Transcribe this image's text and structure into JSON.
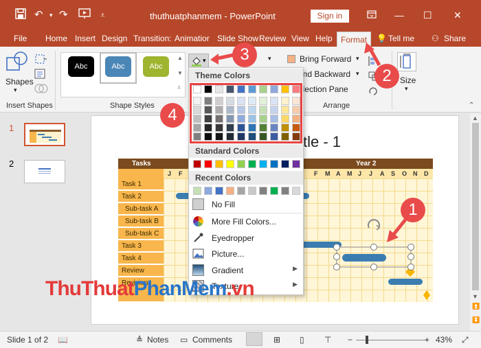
{
  "titlebar": {
    "doc_title": "thuthuatphanmem  -  PowerPoint",
    "sign_in": "Sign in"
  },
  "tabs": [
    "File",
    "Home",
    "Insert",
    "Design",
    "Transition:",
    "Animatior",
    "Slide Show",
    "Review",
    "View",
    "Help",
    "Format"
  ],
  "tell_me": "Tell me",
  "share": "Share",
  "ribbon": {
    "shapes_label": "Shapes",
    "insert_shapes": "Insert Shapes",
    "shape_styles": "Shape Styles",
    "style_boxes": [
      "Abc",
      "Abc",
      "Abc"
    ],
    "bring_forward": "Bring Forward",
    "send_backward": "Send Backward",
    "selection_pane": "Selection Pane",
    "arrange": "Arrange",
    "size": "Size"
  },
  "dropdown": {
    "theme_colors": "Theme Colors",
    "standard_colors": "Standard Colors",
    "recent_colors": "Recent Colors",
    "no_fill": "No Fill",
    "more_fill_colors": "More Fill Colors...",
    "eyedropper": "Eyedropper",
    "picture": "Picture...",
    "gradient": "Gradient",
    "texture": "Texture",
    "theme_top": [
      "#ffffff",
      "#000000",
      "#e7e6e6",
      "#44546a",
      "#4472c4",
      "#5b9bd5",
      "#a9d18e",
      "#8ea9db",
      "#ffc000",
      "#ff7c80"
    ],
    "theme_cols": [
      [
        "#f2f2f2",
        "#d9d9d9",
        "#bfbfbf",
        "#a6a6a6",
        "#808080"
      ],
      [
        "#7f7f7f",
        "#595959",
        "#404040",
        "#262626",
        "#0d0d0d"
      ],
      [
        "#d0cece",
        "#aeabab",
        "#757171",
        "#3a3838",
        "#171616"
      ],
      [
        "#d6dce4",
        "#adb9ca",
        "#8497b0",
        "#333f4f",
        "#222a35"
      ],
      [
        "#dae3f3",
        "#b4c7e7",
        "#8faadc",
        "#2f5597",
        "#203864"
      ],
      [
        "#deebf7",
        "#bdd7ee",
        "#9dc3e6",
        "#2e75b6",
        "#1f4e79"
      ],
      [
        "#e2f0d9",
        "#c5e0b4",
        "#a9d18e",
        "#548235",
        "#385723"
      ],
      [
        "#dae3f3",
        "#c5d2ee",
        "#a8bde6",
        "#6a85c2",
        "#3e5ca0"
      ],
      [
        "#fff2cc",
        "#ffe699",
        "#ffd966",
        "#bf9000",
        "#7f6000"
      ],
      [
        "#fbe5d6",
        "#f8cbad",
        "#f4b183",
        "#c55a11",
        "#843c0c"
      ]
    ],
    "standard": [
      "#c00000",
      "#ff0000",
      "#ffc000",
      "#ffff00",
      "#92d050",
      "#00b050",
      "#00b0f0",
      "#0070c0",
      "#002060",
      "#7030a0"
    ],
    "recent": [
      "#c6e0b4",
      "#8ea9db",
      "#4472c4",
      "#f4b183",
      "#a6a6a6",
      "#c9c9c9",
      "#808080",
      "#00b050",
      "#808080",
      "#d9d9d9"
    ]
  },
  "slide_panel": {
    "numbers": [
      "1",
      "2"
    ]
  },
  "slide": {
    "title_partial": "tle - 1",
    "year2": "Year 2",
    "months_y2": [
      "F",
      "M",
      "A",
      "M",
      "J",
      "J",
      "A",
      "S",
      "O",
      "N",
      "D"
    ],
    "months_y1_partial": [
      "J",
      "F"
    ],
    "tasks_header": "Tasks",
    "tasks": [
      "Task 1",
      "Task 2",
      "Sub-task A",
      "Sub-task B",
      "Sub-task C",
      "Task 3",
      "Task 4",
      "Review",
      "Revisions"
    ]
  },
  "callouts": [
    "1",
    "2",
    "3",
    "4"
  ],
  "watermark": {
    "part1": "ThuThuat",
    "part2": "PhanMem",
    "part3": ".vn"
  },
  "status": {
    "slide_info": "Slide 1 of 2",
    "notes": "Notes",
    "comments": "Comments",
    "zoom": "43%"
  },
  "colors": {
    "accent": "#b7472a",
    "callout": "#e94b4b",
    "gantt_bar": "#3b7db1"
  }
}
